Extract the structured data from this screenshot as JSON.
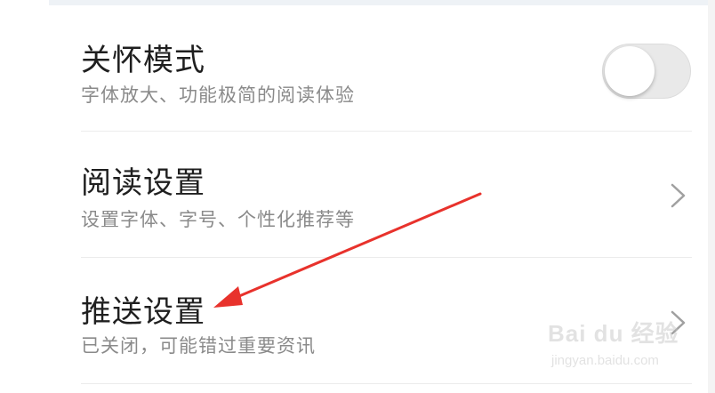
{
  "settings": {
    "items": [
      {
        "title": "关怀模式",
        "subtitle": "字体放大、功能极简的阅读体验",
        "control": "toggle",
        "toggle_on": false
      },
      {
        "title": "阅读设置",
        "subtitle": "设置字体、字号、个性化推荐等",
        "control": "chevron"
      },
      {
        "title": "推送设置",
        "subtitle": "已关闭，可能错过重要资讯",
        "control": "chevron"
      }
    ]
  },
  "annotation": {
    "arrow_color": "#e8322c",
    "target": "推送设置"
  },
  "watermark": {
    "logo": "Bai du 经验",
    "url": "jingyan.baidu.com"
  },
  "colors": {
    "title": "#1f1f1f",
    "subtitle": "#8a8a8a",
    "divider": "#ececec",
    "toggle_off": "#e9e9e9",
    "chevron": "#a0a0a0"
  }
}
